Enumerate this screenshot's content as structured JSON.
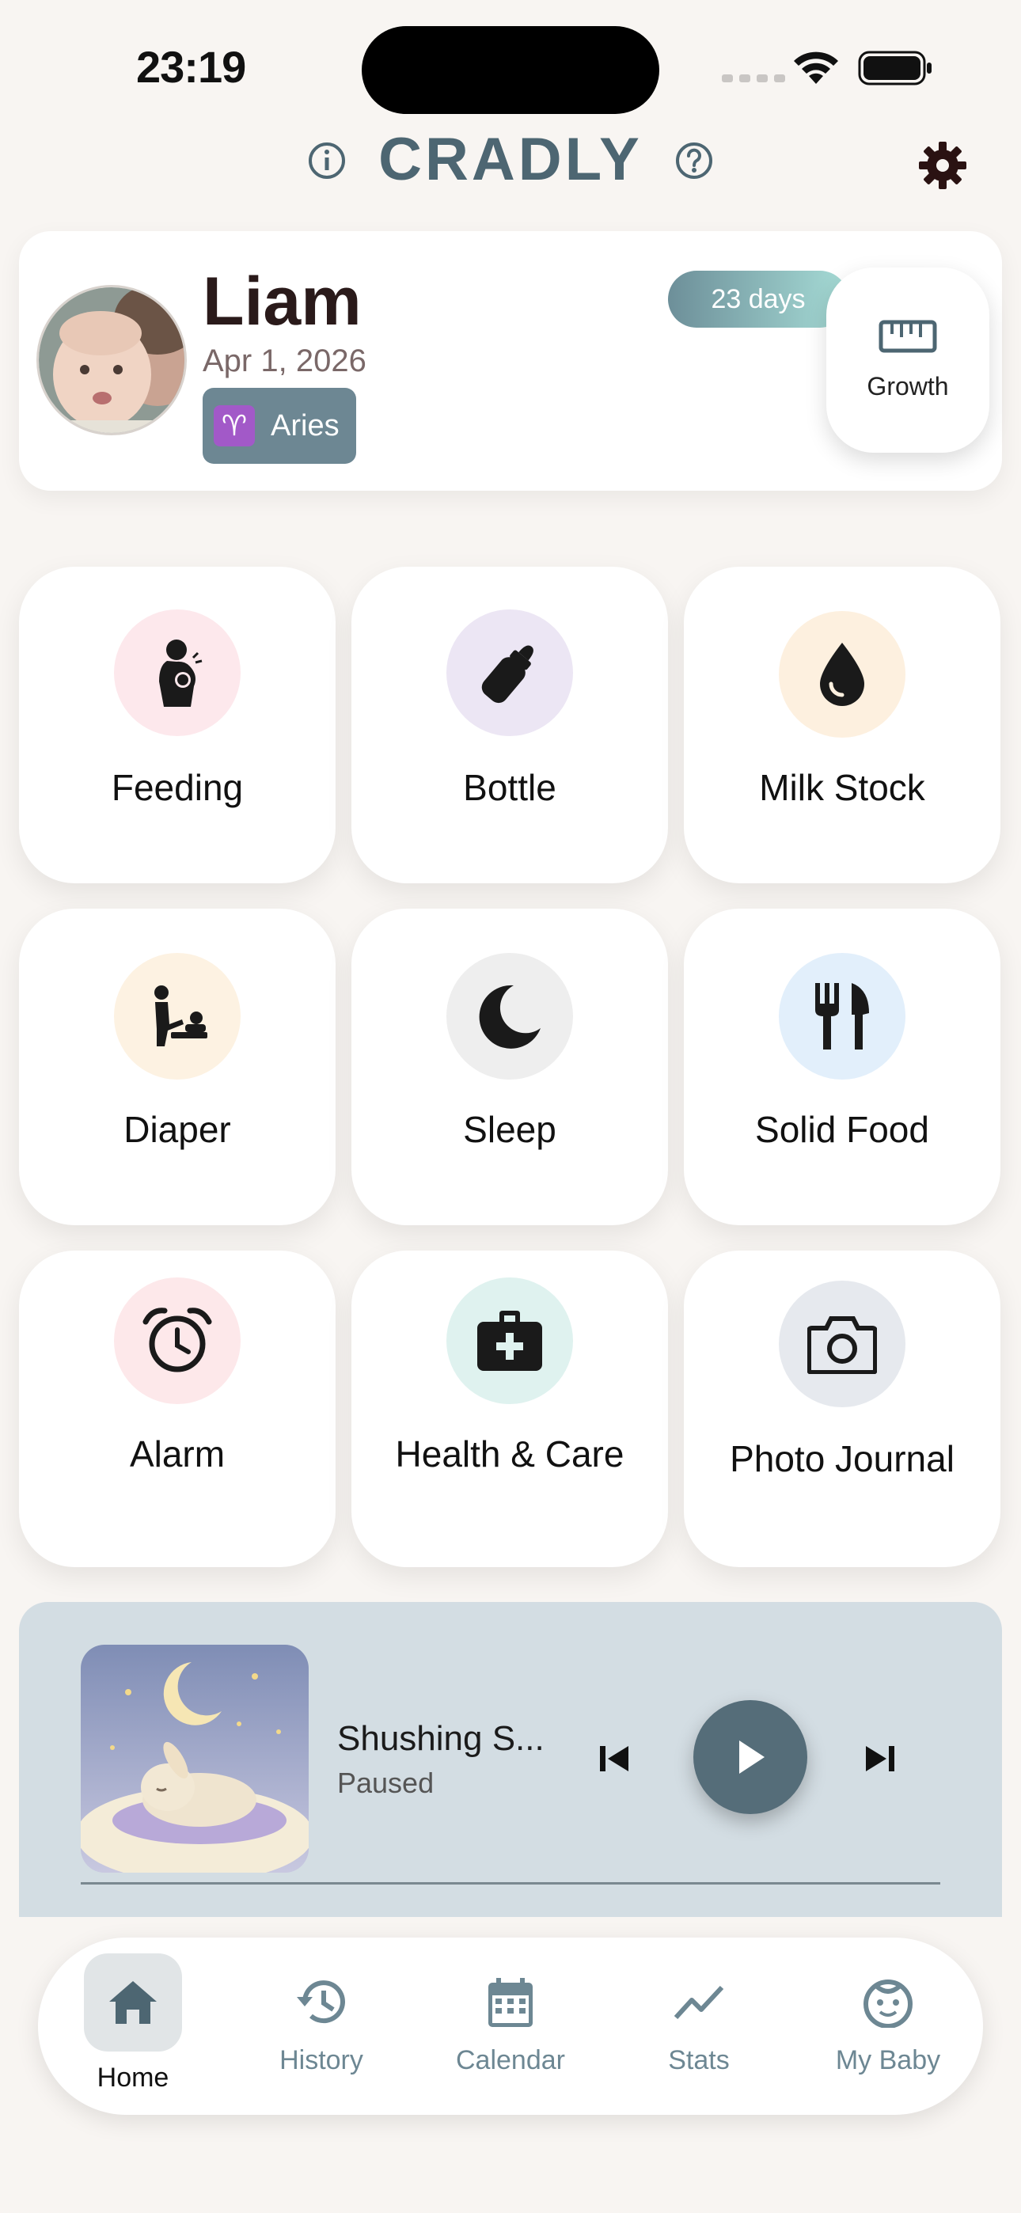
{
  "status_bar": {
    "time": "23:19"
  },
  "header": {
    "title": "CRADLY"
  },
  "profile": {
    "name": "Liam",
    "birth_date": "Apr 1, 2026",
    "zodiac_symbol": "♈",
    "zodiac_label": "Aries",
    "age_badge": "23 days",
    "growth_label": "Growth"
  },
  "tiles": [
    {
      "label": "Feeding",
      "icon": "breastfeeding-icon",
      "bg": "#fde8ec"
    },
    {
      "label": "Bottle",
      "icon": "baby-bottle-icon",
      "bg": "#ece6f4"
    },
    {
      "label": "Milk Stock",
      "icon": "milk-drop-icon",
      "bg": "#fdf0df"
    },
    {
      "label": "Diaper",
      "icon": "diaper-change-icon",
      "bg": "#fdf2e2"
    },
    {
      "label": "Sleep",
      "icon": "moon-icon",
      "bg": "#eeeeee"
    },
    {
      "label": "Solid Food",
      "icon": "fork-knife-icon",
      "bg": "#e2effb"
    },
    {
      "label": "Alarm",
      "icon": "alarm-clock-icon",
      "bg": "#fde8ea"
    },
    {
      "label": "Health & Care",
      "icon": "medical-kit-icon",
      "bg": "#dff2ef"
    },
    {
      "label": "Photo Journal",
      "icon": "camera-icon",
      "bg": "#e6e9ee"
    }
  ],
  "player": {
    "title": "Shushing S...",
    "status": "Paused",
    "progress": 0
  },
  "nav": [
    {
      "label": "Home",
      "icon": "home-icon",
      "active": true
    },
    {
      "label": "History",
      "icon": "history-icon",
      "active": false
    },
    {
      "label": "Calendar",
      "icon": "calendar-icon",
      "active": false
    },
    {
      "label": "Stats",
      "icon": "stats-icon",
      "active": false
    },
    {
      "label": "My Baby",
      "icon": "baby-face-icon",
      "active": false
    }
  ],
  "colors": {
    "accent": "#4d6672",
    "background": "#f8f5f2",
    "player_bg": "#d3dde3"
  }
}
